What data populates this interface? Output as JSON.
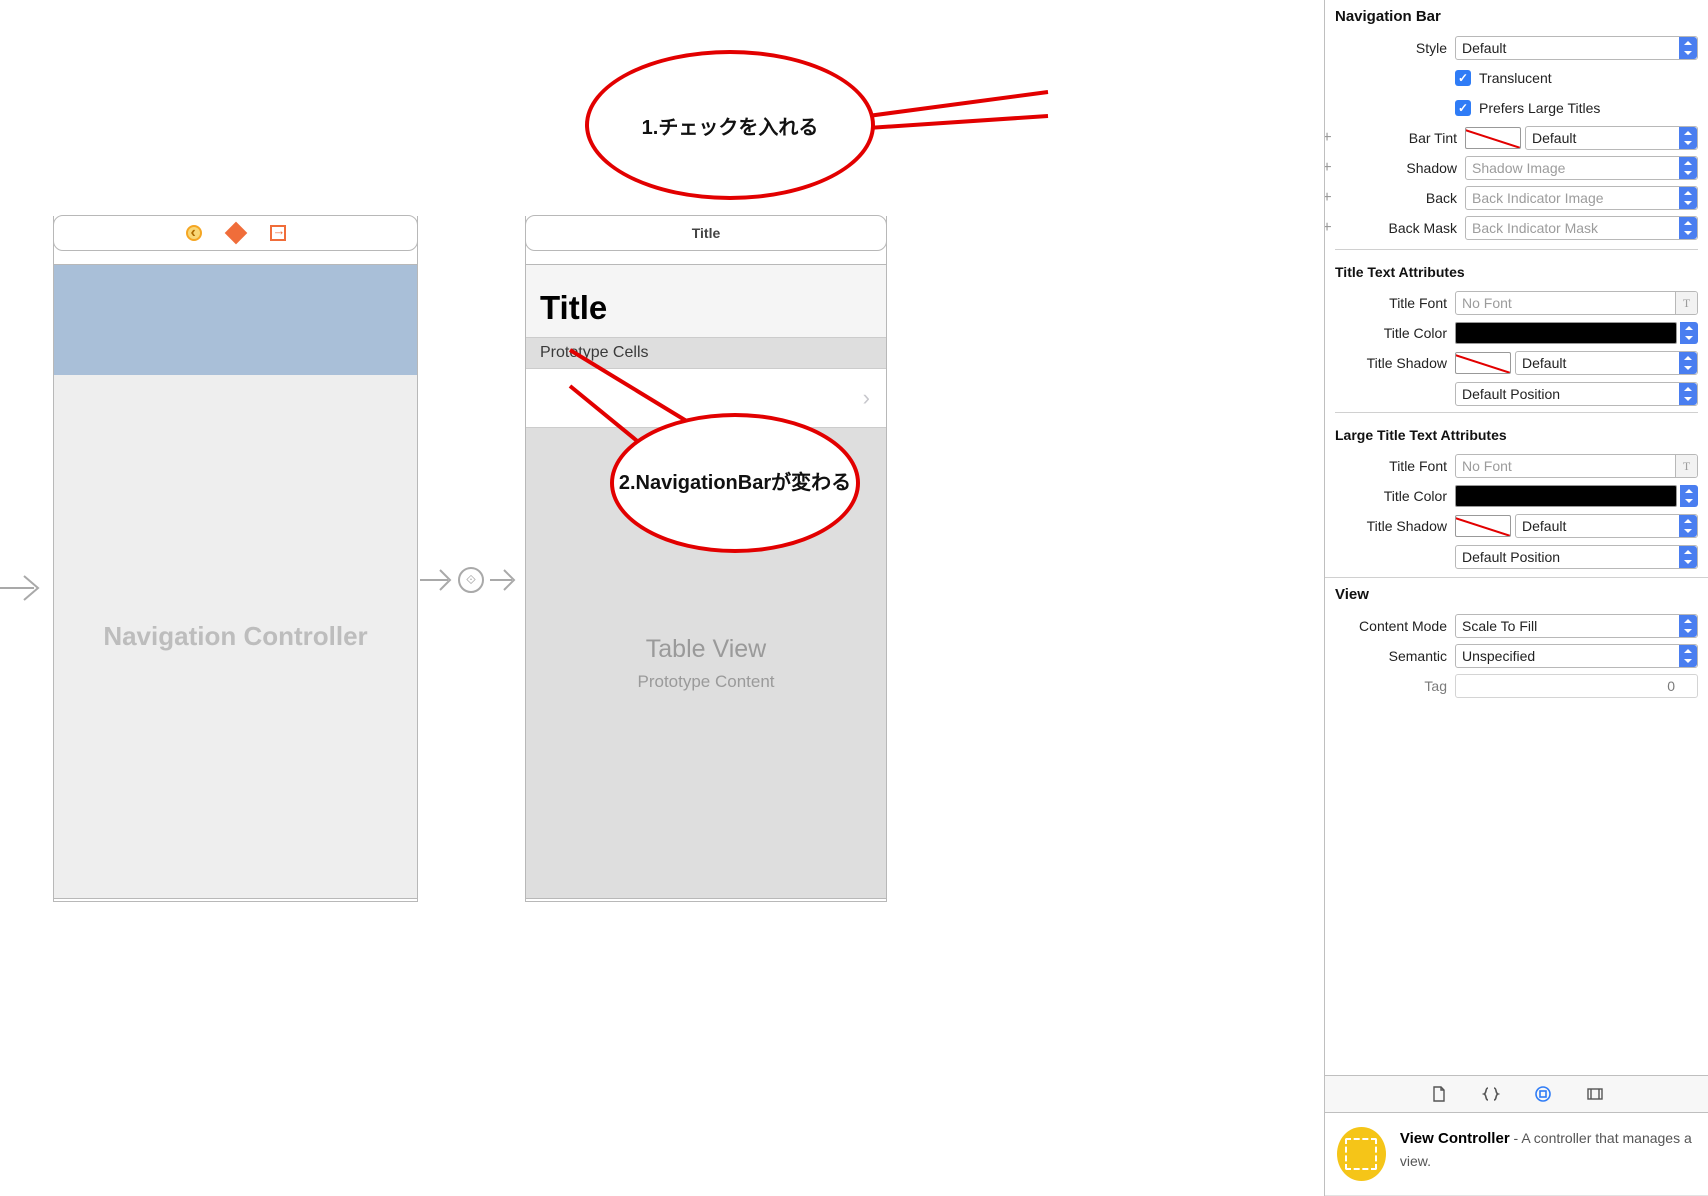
{
  "canvas": {
    "nav_scene": {
      "center_label": "Navigation Controller"
    },
    "tv_scene": {
      "header_title": "Title",
      "large_title": "Title",
      "prototype_cells": "Prototype Cells",
      "tv_label": "Table View",
      "tv_sublabel": "Prototype Content"
    }
  },
  "annotations": {
    "callout1": "1.チェックを入れる",
    "callout2_line1": "2.NavigationBarが変わる"
  },
  "inspector": {
    "section_nav_bar": "Navigation Bar",
    "style_label": "Style",
    "style_value": "Default",
    "translucent_label": "Translucent",
    "prefers_large_label": "Prefers Large Titles",
    "bar_tint_label": "Bar Tint",
    "bar_tint_value": "Default",
    "shadow_label": "Shadow",
    "shadow_placeholder": "Shadow Image",
    "back_label": "Back",
    "back_placeholder": "Back Indicator Image",
    "back_mask_label": "Back Mask",
    "back_mask_placeholder": "Back Indicator Mask",
    "section_title_attrs": "Title Text Attributes",
    "title_font_label": "Title Font",
    "title_font_placeholder": "No Font",
    "title_color_label": "Title Color",
    "title_shadow_label": "Title Shadow",
    "title_shadow_value": "Default",
    "title_shadow_pos": "Default Position",
    "section_large_attrs": "Large Title Text Attributes",
    "section_view": "View",
    "content_mode_label": "Content Mode",
    "content_mode_value": "Scale To Fill",
    "semantic_label": "Semantic",
    "semantic_value": "Unspecified",
    "tag_label": "Tag",
    "tag_value": "0"
  },
  "library": {
    "item_title": "View Controller",
    "item_desc": " - A controller that manages a view."
  }
}
